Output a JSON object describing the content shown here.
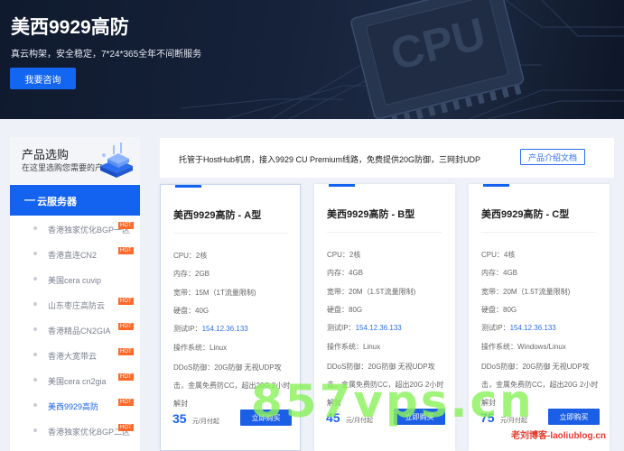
{
  "hero": {
    "title": "美西9929高防",
    "subtitle": "真云构架，安全稳定，7*24*365全年不间断服务",
    "consult_label": "我要咨询",
    "bg_text": "CPU"
  },
  "sidebar": {
    "title": "产品选购",
    "subtitle": "在这里选购您需要的产品",
    "active_section": {
      "dash": "—",
      "label": "云服务器"
    },
    "items": [
      {
        "label": "香港独家优化BGP一区",
        "hot": true
      },
      {
        "label": "香港直连CN2",
        "hot": true
      },
      {
        "label": "美国cera cuvip",
        "hot": false
      },
      {
        "label": "山东枣庄高防云",
        "hot": true
      },
      {
        "label": "香港精品CN2GIA",
        "hot": true
      },
      {
        "label": "香港大宽带云",
        "hot": true
      },
      {
        "label": "美国cera cn2gia",
        "hot": true
      },
      {
        "label": "美西9929高防",
        "hot": true,
        "selected": true
      },
      {
        "label": "香港独家优化BGP二区",
        "hot": true
      }
    ],
    "hot_label": "HOT"
  },
  "banner": {
    "text": "托管于HostHub机房，接入9929 CU Premium线路，免费提供20G防御，三网封UDP",
    "doc_button": "产品介绍文档"
  },
  "plans": [
    {
      "name": "美西9929高防 - A型",
      "specs": [
        {
          "key": "CPU：",
          "value": "2核"
        },
        {
          "key": "内存：",
          "value": "2GB"
        },
        {
          "key": "宽带：",
          "value": "15M（1T流量限制)"
        },
        {
          "key": "硬盘：",
          "value": "40G"
        },
        {
          "key": "测试IP：",
          "value": "154.12.36.133"
        },
        {
          "key": "操作系统：",
          "value": "Linux"
        }
      ],
      "ddos": "DDoS防御：20G防御 无视UDP攻击，金属免费防CC，超出20G 2小时解封",
      "price": "35",
      "unit": "元/月付起",
      "buy_label": "立即购买"
    },
    {
      "name": "美西9929高防 - B型",
      "specs": [
        {
          "key": "CPU：",
          "value": "2核"
        },
        {
          "key": "内存：",
          "value": "4GB"
        },
        {
          "key": "宽带：",
          "value": "20M（1.5T流量限制)"
        },
        {
          "key": "硬盘：",
          "value": "80G"
        },
        {
          "key": "测试IP：",
          "value": "154.12.36.133"
        },
        {
          "key": "操作系统：",
          "value": "Linux"
        }
      ],
      "ddos": "DDoS防御：20G防御 无视UDP攻击，金属免费防CC，超出20G 2小时解封",
      "price": "45",
      "unit": "元/月付起",
      "buy_label": "立即购买"
    },
    {
      "name": "美西9929高防 - C型",
      "specs": [
        {
          "key": "CPU：",
          "value": "4核"
        },
        {
          "key": "内存：",
          "value": "4GB"
        },
        {
          "key": "宽带：",
          "value": "20M（1.5T流量限制)"
        },
        {
          "key": "硬盘：",
          "value": "80G"
        },
        {
          "key": "测试IP：",
          "value": "154.12.36.133"
        },
        {
          "key": "操作系统：",
          "value": "Windows/Linux"
        }
      ],
      "ddos": "DDoS防御：20G防御 无视UDP攻击，金属免费防CC，超出20G 2小时解封",
      "price": "75",
      "unit": "元/月付起",
      "buy_label": "立即购买"
    }
  ],
  "watermark": {
    "big": "857vps.cn",
    "small": "老刘博客-laoliublog.cn"
  },
  "colors": {
    "accent": "#1463f0",
    "hero_bg": "#131e33",
    "hot": "#ff6a2b",
    "watermark_green": "#8af25c",
    "watermark_red": "#e63b2e"
  }
}
